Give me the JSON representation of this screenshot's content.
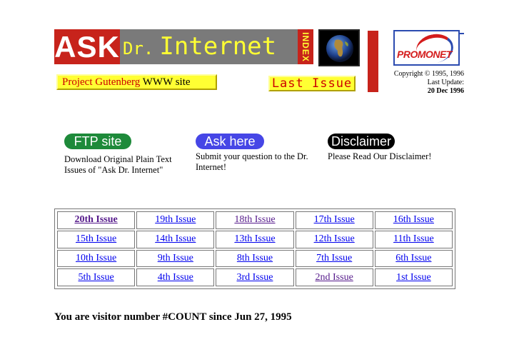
{
  "banner": {
    "ask": "ASK",
    "dr": "Dr.",
    "internet": "Internet",
    "index": "INDEX"
  },
  "links": {
    "gutenberg_red": "Project Gutenberg",
    "gutenberg_rest": " WWW site",
    "last_issue": "Last Issue"
  },
  "promonet": {
    "label": "PROMONET"
  },
  "copyright": {
    "line1": "Copyright © 1995, 1996",
    "line2": "Last Update:",
    "line3": "20 Dec 1996"
  },
  "actions": [
    {
      "label": "FTP site",
      "description": "Download Original Plain Text Issues of \"Ask Dr. Internet\""
    },
    {
      "label": "Ask here",
      "description": "Submit your question to the Dr. Internet!"
    },
    {
      "label": "Disclaimer",
      "description": "Please Read Our Disclaimer!"
    }
  ],
  "issues": [
    [
      "20th Issue",
      "19th Issue",
      "18th Issue",
      "17th Issue",
      "16th Issue"
    ],
    [
      "15th Issue",
      "14th Issue",
      "13th Issue",
      "12th Issue",
      "11th Issue"
    ],
    [
      "10th Issue",
      "9th Issue",
      "8th Issue",
      "7th Issue",
      "6th Issue"
    ],
    [
      "5th Issue",
      "4th Issue",
      "3rd Issue",
      "2nd Issue",
      "1st Issue"
    ]
  ],
  "visitor": "You are visitor number #COUNT since Jun 27, 1995",
  "colors": {
    "banner_red": "#c7231b",
    "banner_gray": "#7a7a7a",
    "banner_yellow": "#ffff33",
    "link": "#0000ee",
    "visited": "#551a8b",
    "ftp_green": "#1e8a3a",
    "ask_blue": "#4646e6"
  },
  "icons": [
    "globe-icon",
    "promonet-logo"
  ]
}
